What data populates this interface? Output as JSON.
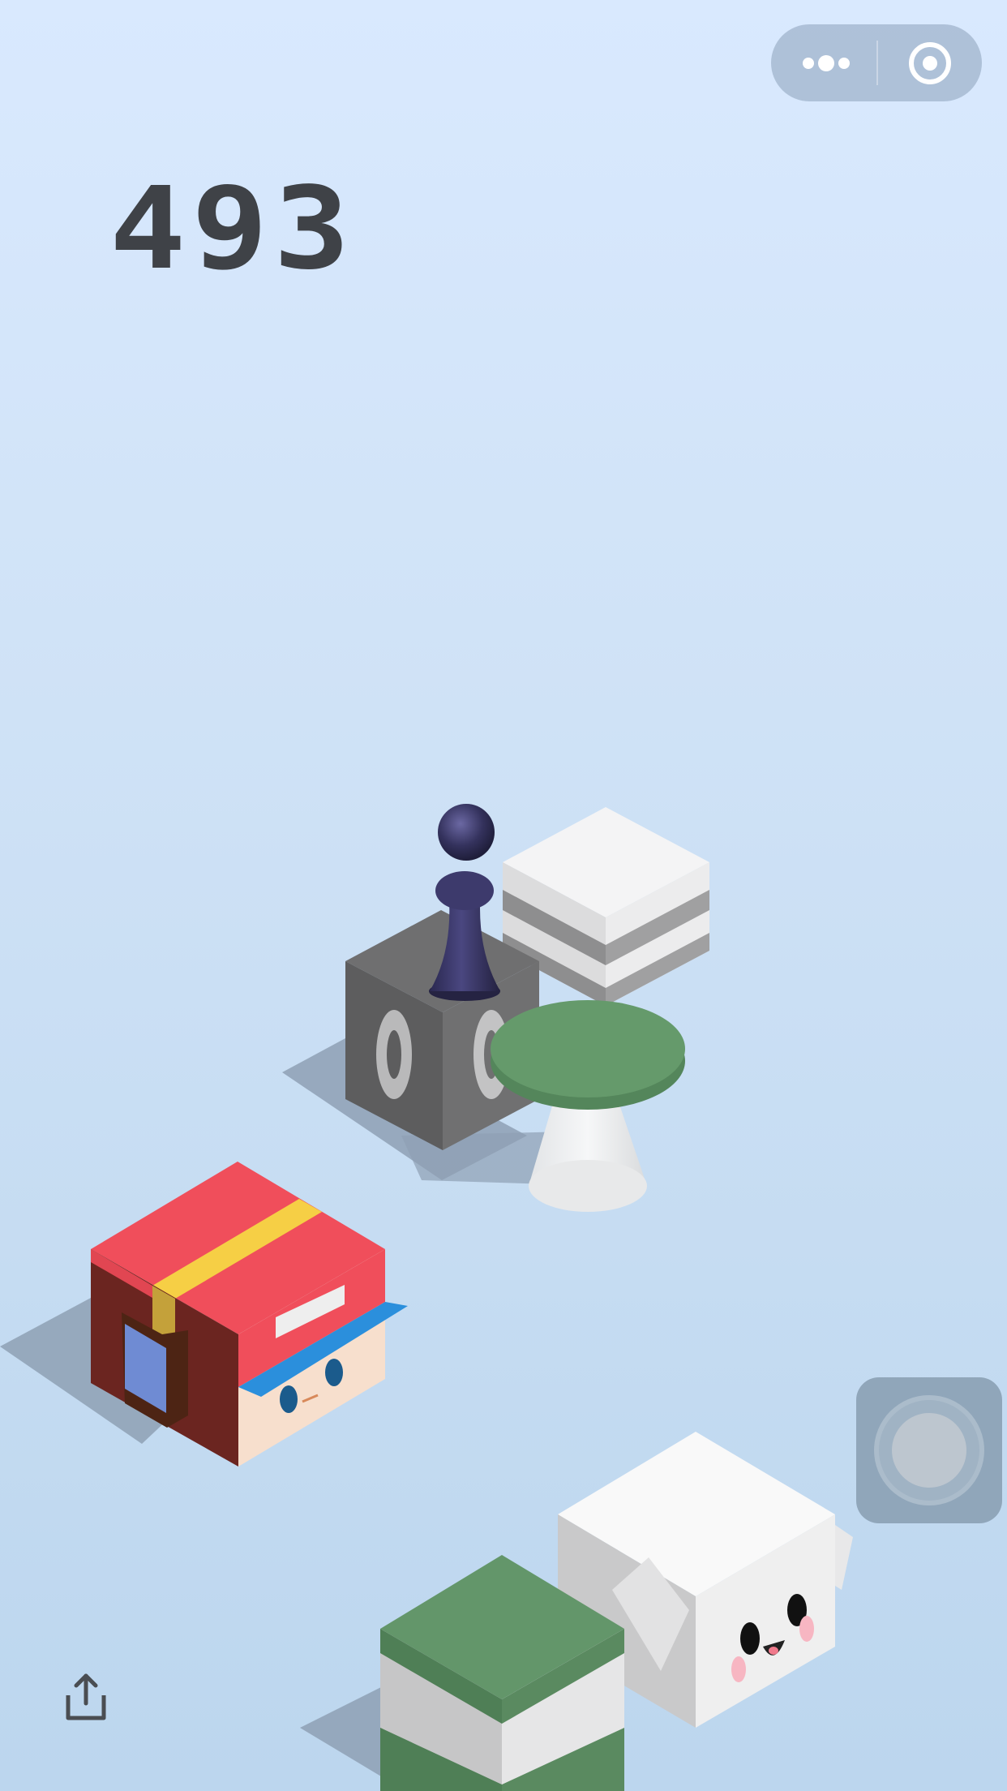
{
  "game": {
    "score": "493"
  },
  "capsule": {
    "more_icon": "more-dots-icon",
    "close_icon": "target-close-icon"
  },
  "controls": {
    "share_icon": "share-upload-icon",
    "side_button_icon": "floating-circle-icon"
  },
  "colors": {
    "background_top": "#d9e9fe",
    "background_bottom": "#bcd6ee",
    "score": "#3f4247",
    "piece": "#2f2d55",
    "red_box": "#f04e5b",
    "green": "#63966a",
    "gray_box": "#6a6a6a"
  },
  "scene": {
    "platforms": [
      {
        "name": "gray-cube-platform"
      },
      {
        "name": "striped-white-platform"
      },
      {
        "name": "green-table-platform"
      },
      {
        "name": "red-cap-character-box"
      },
      {
        "name": "white-face-box"
      },
      {
        "name": "green-white-box"
      }
    ],
    "player": {
      "name": "jumping-piece"
    }
  }
}
